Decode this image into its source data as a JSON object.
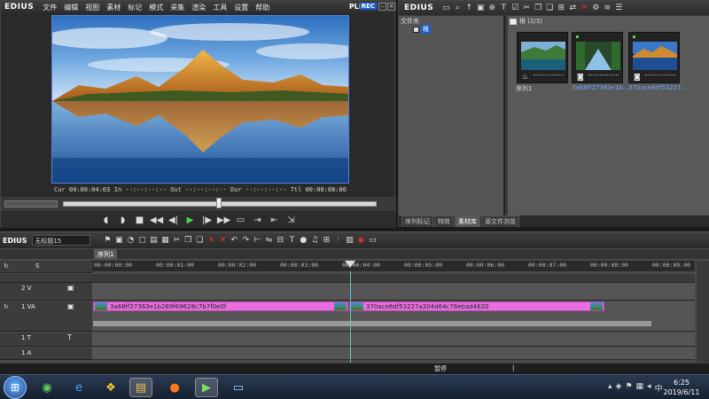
{
  "player": {
    "logo": "EDIUS",
    "menu": [
      "文件",
      "编辑",
      "视图",
      "素材",
      "标记",
      "模式",
      "采集",
      "渲染",
      "工具",
      "设置",
      "帮助"
    ],
    "plr": "PLR",
    "rec": "REC",
    "timecodes": {
      "cur_label": "Cur",
      "cur": "00:00:04:03",
      "in_label": "In",
      "in": "--:--:--:--",
      "out_label": "Out",
      "out": "--:--:--:--",
      "dur_label": "Dur",
      "dur": "--:--:--:--",
      "ttl_label": "Ttl",
      "ttl": "00:00:08:06"
    },
    "transport_icons": [
      "set-in-icon",
      "set-out-icon",
      "stop-icon",
      "rewind-icon",
      "step-back-icon",
      "play-icon",
      "step-forward-icon",
      "fast-forward-icon",
      "output-icon",
      "insert-icon",
      "overwrite-icon",
      "extract-icon"
    ]
  },
  "bin": {
    "logo": "EDIUS",
    "folder_header": "文件夹",
    "folder_root": "根",
    "clip_header": "根 (2/3)",
    "clips": [
      {
        "label": "序列1",
        "selected": false
      },
      {
        "label": "3a68ff27363e1b...",
        "selected": true
      },
      {
        "label": "370ace8df53227...",
        "selected": true
      }
    ],
    "tabs": [
      {
        "label": "序列标记",
        "active": false
      },
      {
        "label": "特效",
        "active": false
      },
      {
        "label": "素材库",
        "active": true
      },
      {
        "label": "源文件浏览",
        "active": false
      }
    ]
  },
  "timeline": {
    "logo": "EDIUS",
    "project_name": "无标题15",
    "sequence_tab": "序列1",
    "ruler": [
      "00:00:00:00",
      "00:00:01:00",
      "00:00:02:00",
      "00:00:03:00",
      "00:00:04:00",
      "00:00:05:00",
      "00:00:06:00",
      "00:00:07:00",
      "00:00:08:00",
      "00:00:09:00"
    ],
    "tracks": [
      {
        "name": "",
        "kind": "header"
      },
      {
        "name": "2 V",
        "kind": "video"
      },
      {
        "name": "1 VA",
        "kind": "videoaudio"
      },
      {
        "name": "1 T",
        "kind": "title"
      },
      {
        "name": "1 A",
        "kind": "audio"
      }
    ],
    "clips": [
      {
        "name": "3a68ff27363e1b289f69628c7b7f0e0f",
        "start_s": 0,
        "end_s": 4.0
      },
      {
        "name": "370ace8df53227a204d64c76ebad4620",
        "start_s": 4.0,
        "end_s": 8.0
      }
    ],
    "playhead_s": 4.12,
    "status": "暂停"
  },
  "taskbar": {
    "time": "6:25",
    "date": "2019/6/11"
  }
}
